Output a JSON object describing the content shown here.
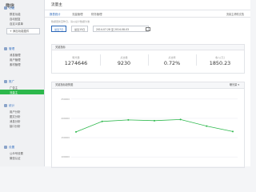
{
  "sidebar": {
    "logo": "微信",
    "sections": [
      {
        "title": "功能",
        "items": [
          "群发功能",
          "自动回复",
          "自定义菜单"
        ],
        "button": "+ 添加功能插件"
      },
      {
        "title": "管理",
        "items": [
          "消息管理",
          "用户管理",
          "素材管理"
        ]
      },
      {
        "title": "推广",
        "items": [
          "广告主",
          "流量主"
        ],
        "active": "流量主"
      },
      {
        "title": "统计",
        "items": [
          "用户分析",
          "图文分析",
          "消息分析",
          "接口分析"
        ]
      },
      {
        "title": "设置",
        "items": [
          "公众号设置",
          "微信认证"
        ]
      }
    ]
  },
  "header": {
    "title": "流量主"
  },
  "tabs": {
    "items": [
      "报表统计",
      "流量管理",
      "财务管理"
    ],
    "active": "报表统计",
    "right": "流量主帮助文档"
  },
  "notice": "数据更新至昨日，请以总计数据为准",
  "controls": {
    "btn1": "最近7日",
    "btn2": "最近15日",
    "date_range": "2014-07-28 至 2014-08-03"
  },
  "overview": {
    "title": "关键指标",
    "metrics": [
      {
        "label": "曝光量",
        "value": "1274646"
      },
      {
        "label": "点击量",
        "value": "9230"
      },
      {
        "label": "点击率",
        "value": "0.72%"
      },
      {
        "label": "收入(元)",
        "value": "1850.23"
      }
    ]
  },
  "trend": {
    "title": "关键指标趋势图",
    "metric_select": "曝光量"
  },
  "colors": {
    "accent": "#2db84c",
    "link": "#2a66b8",
    "line": "#2db84c"
  },
  "chart_data": {
    "type": "line",
    "title": "",
    "yticks": [
      "250000",
      "200000",
      "150000",
      "100000"
    ],
    "x": [
      1,
      2,
      3,
      4,
      5,
      6,
      7
    ],
    "series": [
      {
        "values": [
          165000,
          192000,
          196000,
          194000,
          197000,
          180000,
          166000
        ]
      }
    ],
    "ylim": [
      90000,
      260000
    ],
    "grid": true
  }
}
